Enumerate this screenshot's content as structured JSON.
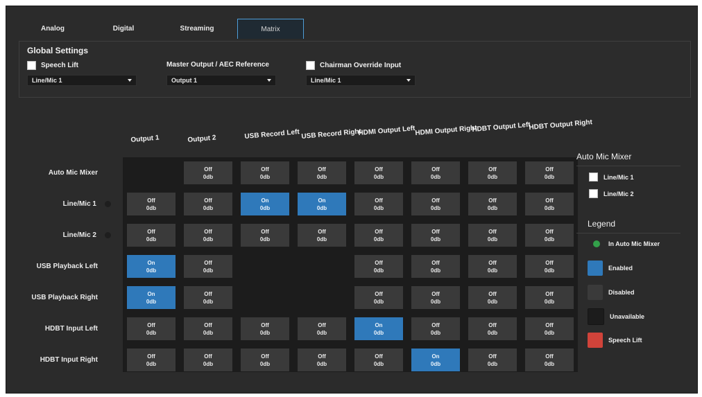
{
  "tabs": [
    "Analog",
    "Digital",
    "Streaming",
    "Matrix"
  ],
  "active_tab": "Matrix",
  "global": {
    "title": "Global Settings",
    "speech_lift": {
      "label": "Speech Lift",
      "select": "Line/Mic 1"
    },
    "master_output": {
      "label": "Master Output / AEC Reference",
      "select": "Output 1"
    },
    "chairman": {
      "label": "Chairman Override Input",
      "select": "Line/Mic 1"
    }
  },
  "columns": [
    "Output 1",
    "Output 2",
    "USB Record Left",
    "USB Record Right",
    "HDMI Output Left",
    "HDMI Output Right",
    "HDBT Output Left",
    "HDBT Output Right"
  ],
  "rows": [
    {
      "label": "Auto Mic Mixer",
      "cells": [
        "",
        "Off|0db",
        "Off|0db",
        "Off|0db",
        "Off|0db",
        "Off|0db",
        "Off|0db",
        "Off|0db"
      ]
    },
    {
      "label": "Line/Mic 1",
      "cells": [
        "Off|0db",
        "Off|0db",
        "On|0db",
        "On|0db",
        "Off|0db",
        "Off|0db",
        "Off|0db",
        "Off|0db"
      ]
    },
    {
      "label": "Line/Mic 2",
      "cells": [
        "Off|0db",
        "Off|0db",
        "Off|0db",
        "Off|0db",
        "Off|0db",
        "Off|0db",
        "Off|0db",
        "Off|0db"
      ]
    },
    {
      "label": "USB Playback Left",
      "cells": [
        "On|0db",
        "Off|0db",
        "",
        "",
        "Off|0db",
        "Off|0db",
        "Off|0db",
        "Off|0db"
      ]
    },
    {
      "label": "USB Playback Right",
      "cells": [
        "On|0db",
        "Off|0db",
        "",
        "",
        "Off|0db",
        "Off|0db",
        "Off|0db",
        "Off|0db"
      ]
    },
    {
      "label": "HDBT Input Left",
      "cells": [
        "Off|0db",
        "Off|0db",
        "Off|0db",
        "Off|0db",
        "On|0db",
        "Off|0db",
        "Off|0db",
        "Off|0db"
      ]
    },
    {
      "label": "HDBT Input Right",
      "cells": [
        "Off|0db",
        "Off|0db",
        "Off|0db",
        "Off|0db",
        "Off|0db",
        "On|0db",
        "Off|0db",
        "Off|0db"
      ]
    }
  ],
  "auto_mic_mixer": {
    "title": "Auto Mic Mixer",
    "items": [
      "Line/Mic 1",
      "Line/Mic 2"
    ]
  },
  "legend": {
    "title": "Legend",
    "items": [
      {
        "label": "In Auto Mic Mixer",
        "color": "#33a04a",
        "kind": "dot"
      },
      {
        "label": "Enabled",
        "color": "#2f79ba",
        "kind": "swatch"
      },
      {
        "label": "Disabled",
        "color": "#3a3a3a",
        "kind": "swatch"
      },
      {
        "label": "Unavailable",
        "color": "#1c1c1c",
        "kind": "swatch"
      },
      {
        "label": "Speech Lift",
        "color": "#d0433a",
        "kind": "swatch"
      }
    ]
  }
}
